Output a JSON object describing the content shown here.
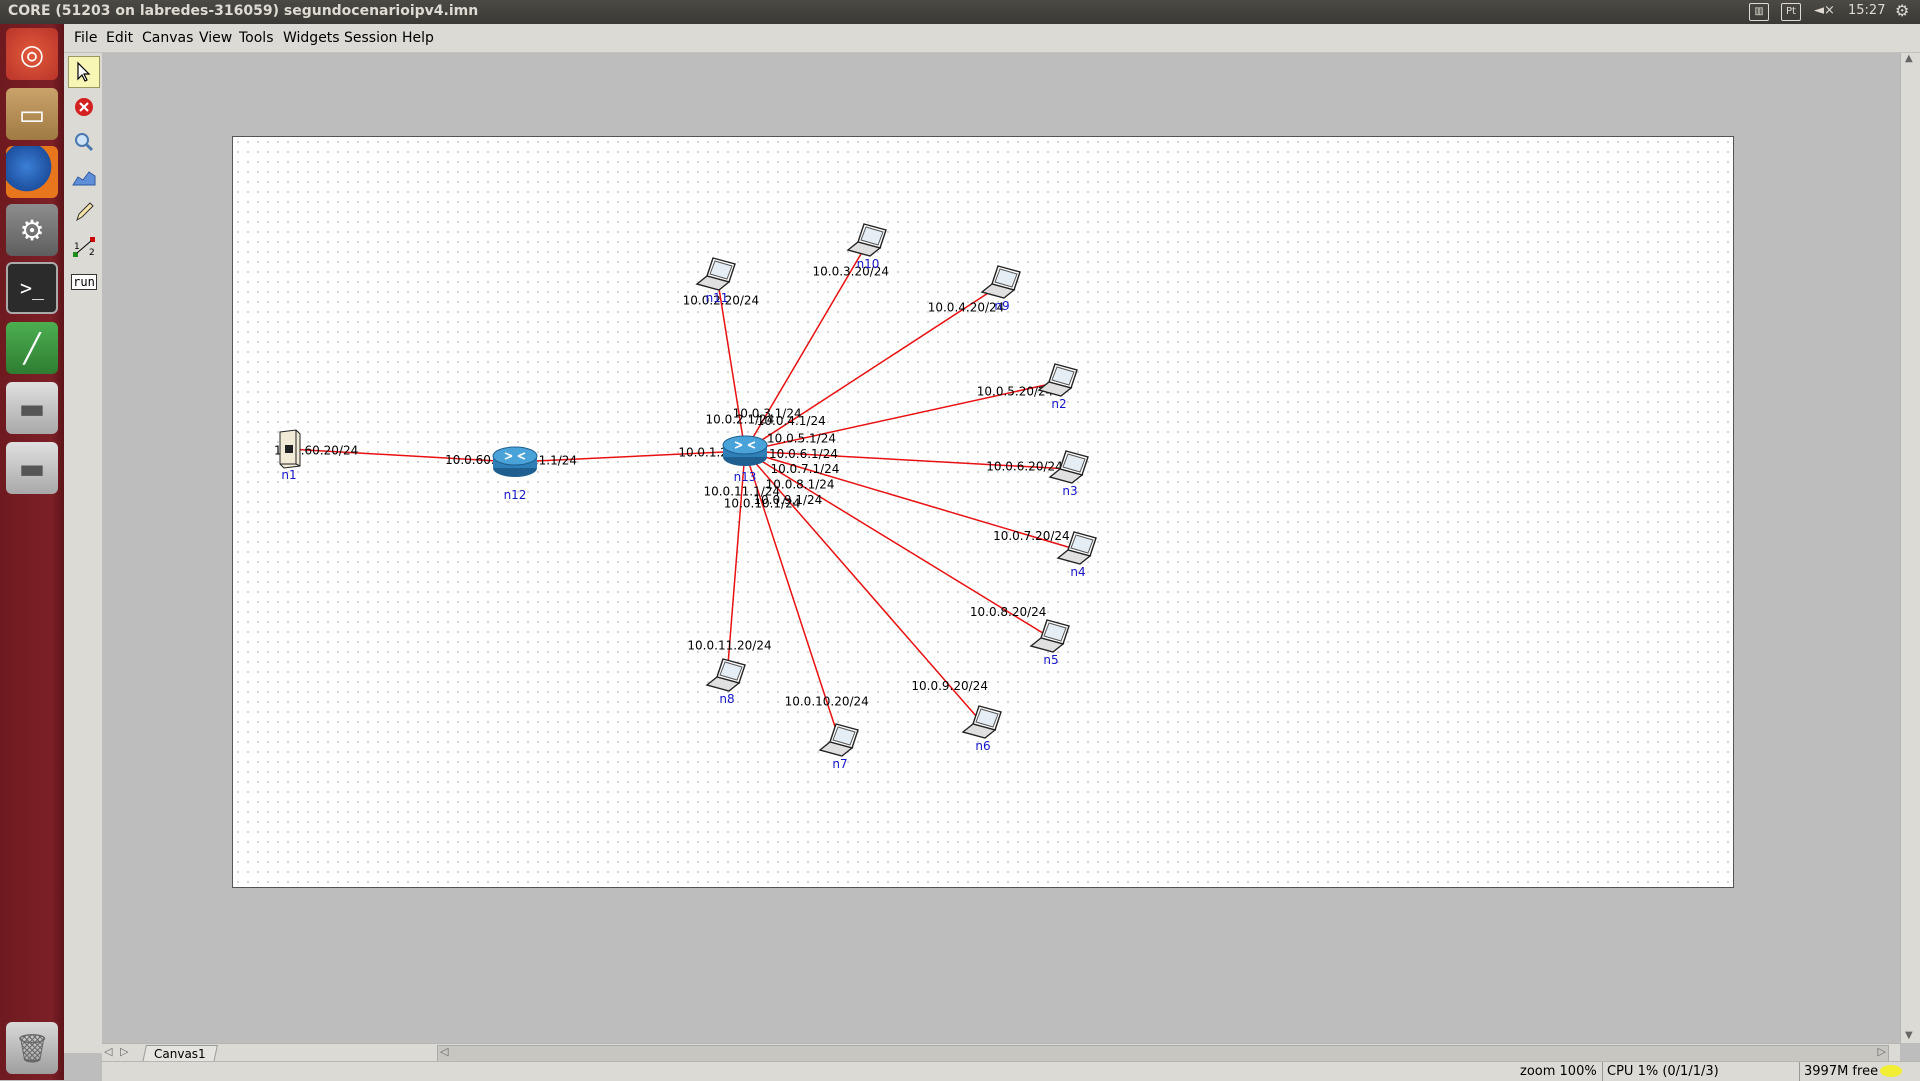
{
  "window": {
    "title": "CORE (51203 on labredes-316059) segundocenarioipv4.imn"
  },
  "tray": {
    "keyboard": "Pt",
    "sound_icon": "speaker-mute-icon",
    "clock": "15:27"
  },
  "menubar": {
    "items": [
      "File",
      "Edit",
      "Canvas",
      "View",
      "Tools",
      "Widgets",
      "Session",
      "Help"
    ]
  },
  "tools": {
    "run_label": "run",
    "link_numbers": [
      "1",
      "2"
    ]
  },
  "canvas": {
    "tab_label": "Canvas1"
  },
  "status": {
    "zoom": "zoom 100%",
    "cpu": "CPU 1% (0/1/1/3)",
    "mem": "3997M free"
  },
  "topology": {
    "nodes": [
      {
        "id": "n1",
        "type": "server"
      },
      {
        "id": "n12",
        "type": "router"
      },
      {
        "id": "n13",
        "type": "router"
      },
      {
        "id": "n11",
        "type": "laptop"
      },
      {
        "id": "n10",
        "type": "laptop"
      },
      {
        "id": "n9",
        "type": "laptop"
      },
      {
        "id": "n2",
        "type": "laptop"
      },
      {
        "id": "n3",
        "type": "laptop"
      },
      {
        "id": "n4",
        "type": "laptop"
      },
      {
        "id": "n5",
        "type": "laptop"
      },
      {
        "id": "n6",
        "type": "laptop"
      },
      {
        "id": "n7",
        "type": "laptop"
      },
      {
        "id": "n8",
        "type": "laptop"
      }
    ],
    "links": [
      {
        "from": "n1",
        "to": "n12",
        "a": "10.0.60.20/24",
        "b": "10.0.60.1/24"
      },
      {
        "from": "n12",
        "to": "n13",
        "a": "10.0.1.1/24",
        "b": "10.0.1.2/24"
      },
      {
        "from": "n13",
        "to": "n11",
        "a": "10.0.2.1/24",
        "b": "10.0.2.20/24"
      },
      {
        "from": "n13",
        "to": "n10",
        "a": "10.0.3.1/24",
        "b": "10.0.3.20/24"
      },
      {
        "from": "n13",
        "to": "n9",
        "a": "10.0.4.1/24",
        "b": "10.0.4.20/24"
      },
      {
        "from": "n13",
        "to": "n2",
        "a": "10.0.5.1/24",
        "b": "10.0.5.20/24"
      },
      {
        "from": "n13",
        "to": "n3",
        "a": "10.0.6.1/24",
        "b": "10.0.6.20/24"
      },
      {
        "from": "n13",
        "to": "n4",
        "a": "10.0.7.1/24",
        "b": "10.0.7.20/24"
      },
      {
        "from": "n13",
        "to": "n5",
        "a": "10.0.8.1/24",
        "b": "10.0.8.20/24"
      },
      {
        "from": "n13",
        "to": "n6",
        "a": "10.0.9.1/24",
        "b": "10.0.9.20/24"
      },
      {
        "from": "n13",
        "to": "n7",
        "a": "10.0.10.1/24",
        "b": "10.0.10.20/24"
      },
      {
        "from": "n13",
        "to": "n8",
        "a": "10.0.11.1/24",
        "b": "10.0.11.20/24"
      }
    ]
  }
}
